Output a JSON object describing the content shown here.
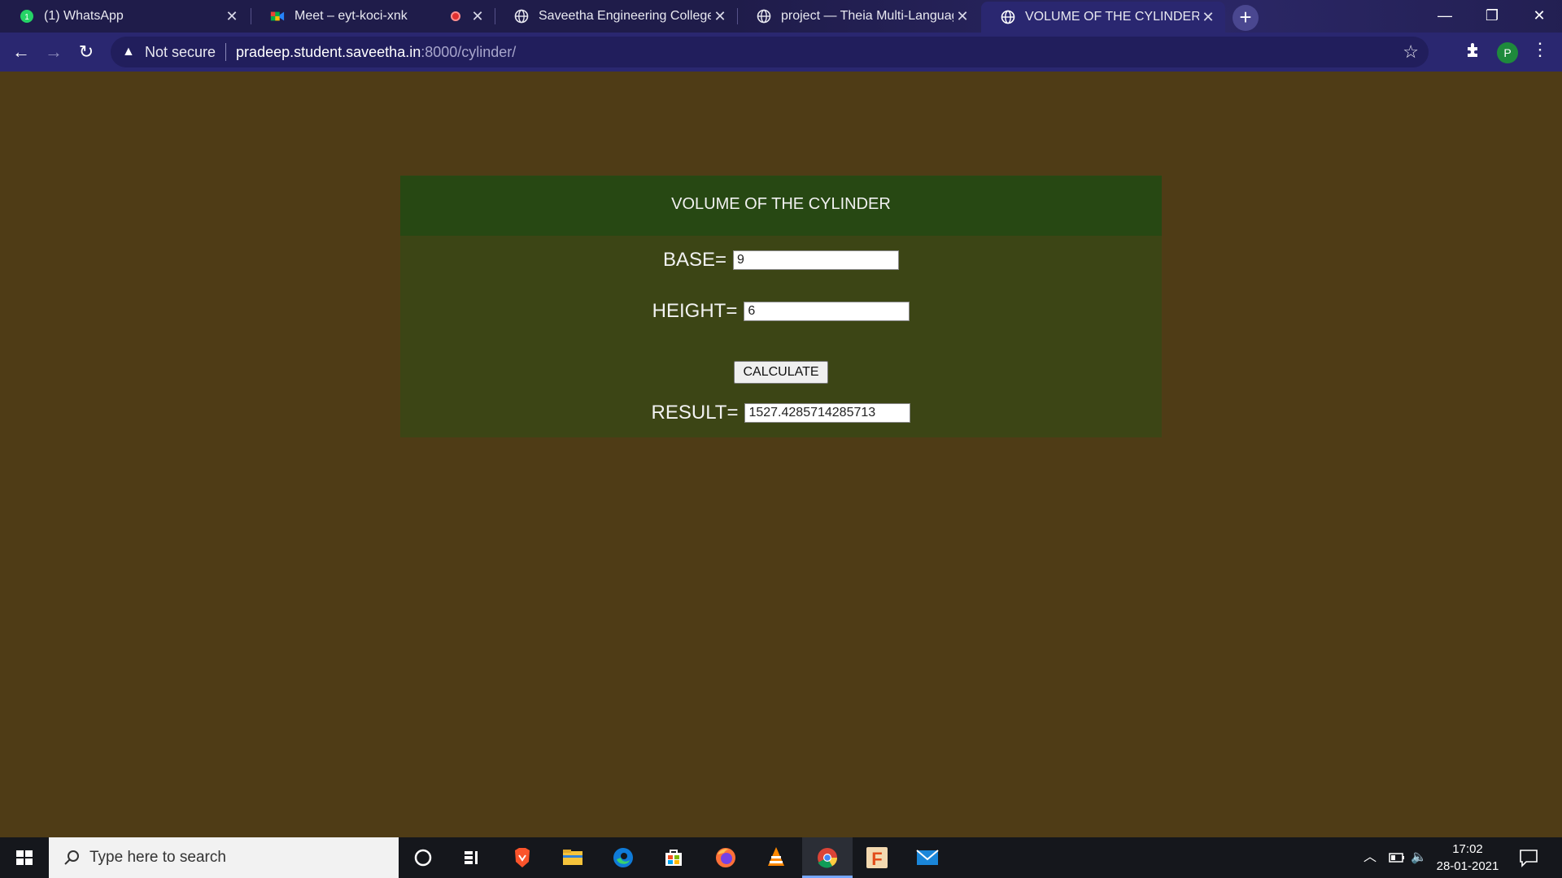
{
  "browser": {
    "tabs": [
      {
        "title": "(1) WhatsApp",
        "icon": "whatsapp-icon",
        "active": false
      },
      {
        "title": "Meet – eyt-koci-xnk",
        "icon": "google-meet-icon",
        "active": false,
        "recording": true
      },
      {
        "title": "Saveetha Engineering College",
        "icon": "globe-icon",
        "active": false
      },
      {
        "title": "project — Theia Multi-Language",
        "icon": "globe-icon",
        "active": false
      },
      {
        "title": "VOLUME OF THE CYLINDER",
        "icon": "globe-icon",
        "active": true
      }
    ],
    "new_tab": "+",
    "address": {
      "security": "Not secure",
      "host": "pradeep.student.saveetha.in",
      "path": ":8000/cylinder/"
    },
    "profile_initial": "P"
  },
  "page": {
    "header": "VOLUME OF THE CYLINDER",
    "base_label": "BASE=",
    "base_value": "9",
    "height_label": "HEIGHT=",
    "height_value": "6",
    "calculate_label": "CALCULATE",
    "result_label": "RESULT=",
    "result_value": "1527.4285714285713"
  },
  "taskbar": {
    "search_placeholder": "Type here to search",
    "time": "17:02",
    "date": "28-01-2021"
  },
  "colors": {
    "page_bg": "#4f3c16",
    "card_bg": "#3c4515",
    "card_header_bg": "#274813",
    "tab_strip_bg": "#1f1c4a",
    "toolbar_bg": "#2a2770"
  }
}
